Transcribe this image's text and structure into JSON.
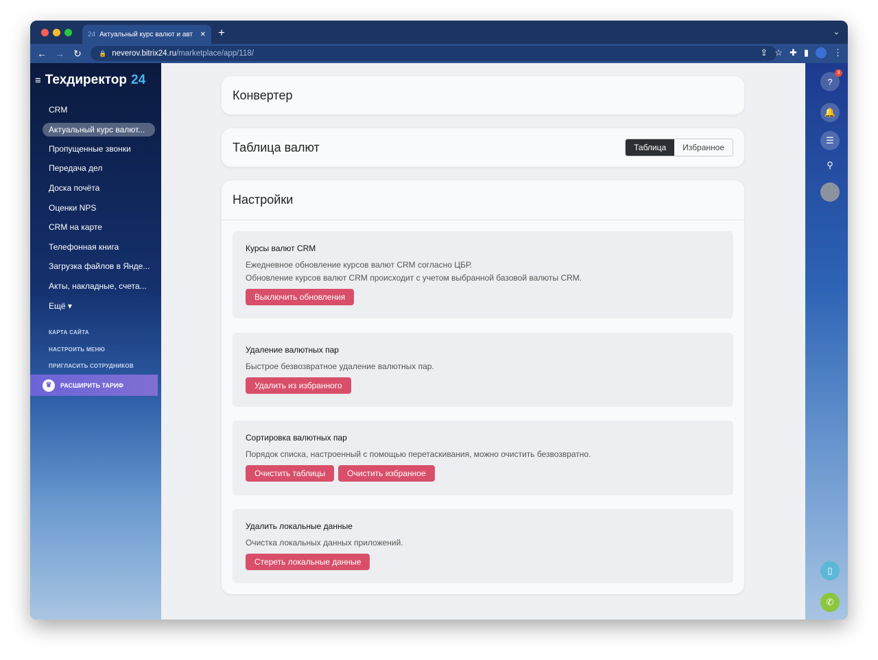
{
  "browser": {
    "tab_title": "Актуальный курс валют и авт",
    "url_host": "neverov.bitrix24.ru",
    "url_path": "/marketplace/app/118/"
  },
  "sidebar": {
    "brand": "Техдиректор",
    "brand_num": "24",
    "items": [
      {
        "label": "CRM"
      },
      {
        "label": "Актуальный курс валют..."
      },
      {
        "label": "Пропущенные звонки"
      },
      {
        "label": "Передача дел"
      },
      {
        "label": "Доска почёта"
      },
      {
        "label": "Оценки NPS"
      },
      {
        "label": "CRM на карте"
      },
      {
        "label": "Телефонная книга"
      },
      {
        "label": "Загрузка файлов в Янде..."
      },
      {
        "label": "Акты, накладные, счета..."
      },
      {
        "label": "Ещё ▾"
      }
    ],
    "sitemap": "КАРТА САЙТА",
    "configure": "НАСТРОИТЬ МЕНЮ",
    "invite": "ПРИГЛАСИТЬ СОТРУДНИКОВ",
    "upgrade": "РАСШИРИТЬ ТАРИФ"
  },
  "main": {
    "converter_title": "Конвертер",
    "table_title": "Таблица валют",
    "tabs": [
      "Таблица",
      "Избранное"
    ],
    "settings_title": "Настройки",
    "sections": [
      {
        "title": "Курсы валют CRM",
        "lines": [
          "Ежедневное обновление курсов валют CRM согласно ЦБР.",
          "Обновление курсов валют CRM происходит с учетом выбранной базовой валюты CRM."
        ],
        "buttons": [
          "Выключить обновления"
        ]
      },
      {
        "title": "Удаление валютных пар",
        "lines": [
          "Быстрое безвозвратное удаление валютных пар."
        ],
        "buttons": [
          "Удалить из избранного"
        ]
      },
      {
        "title": "Сортировка валютных пар",
        "lines": [
          "Порядок списка, настроенный с помощью перетаскивания, можно очистить безвозвратно."
        ],
        "buttons": [
          "Очистить таблицы",
          "Очистить избранное"
        ]
      },
      {
        "title": "Удалить локальные данные",
        "lines": [
          "Очистка локальных данных приложений."
        ],
        "buttons": [
          "Стереть локальные данные"
        ]
      }
    ]
  },
  "right_panel": {
    "help_badge": "3"
  }
}
